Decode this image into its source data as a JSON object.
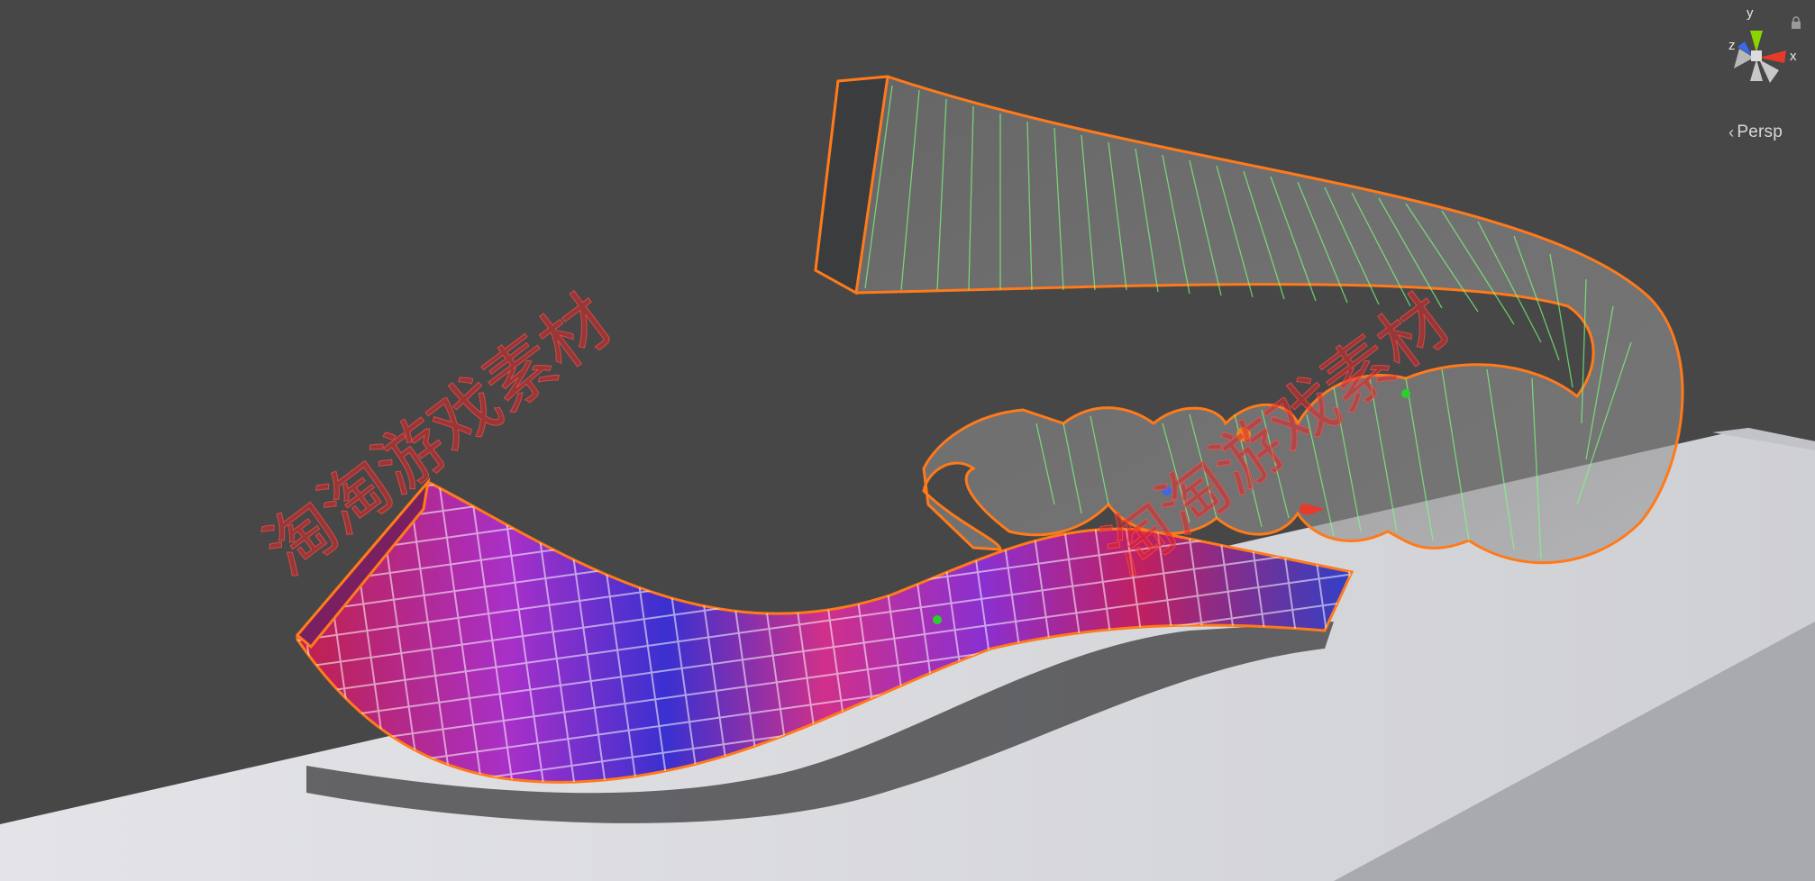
{
  "viewport": {
    "projection_label": "Persp",
    "axis_labels": {
      "x": "x",
      "y": "y",
      "z": "z"
    }
  },
  "watermark": {
    "text_1": "淘淘游戏素材",
    "text_2": "淘淘游戏素材"
  },
  "colors": {
    "background": "#474747",
    "selection_outline": "#ff7a1a",
    "wireframe": "#7dff7d",
    "floor": "#d8d8dc",
    "x_axis": "#e83a2a",
    "y_axis": "#8ad400",
    "z_axis": "#3a6ae8"
  }
}
